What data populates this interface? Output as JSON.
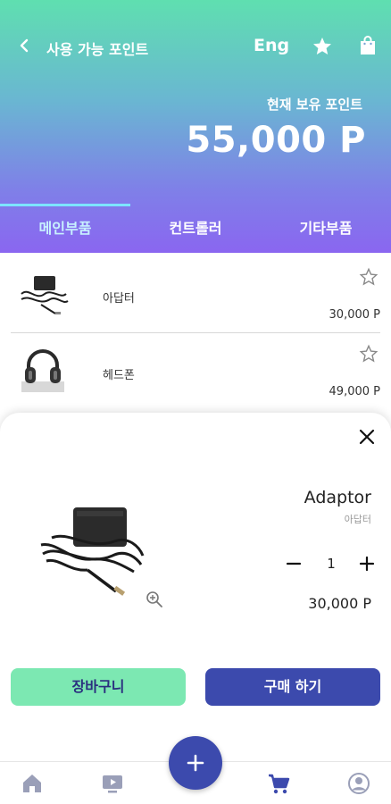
{
  "header": {
    "title": "사용 가능 포인트",
    "lang_label": "Eng",
    "points_label": "현재 보유 포인트",
    "points_value": "55,000 P"
  },
  "tabs": [
    {
      "label": "메인부품",
      "active": true
    },
    {
      "label": "컨트롤러",
      "active": false
    },
    {
      "label": "기타부품",
      "active": false
    }
  ],
  "items": [
    {
      "name": "아답터",
      "price": "30,000 P",
      "icon": "adapter-thumbnail"
    },
    {
      "name": "헤드폰",
      "price": "49,000 P",
      "icon": "headphone-thumbnail"
    }
  ],
  "detail": {
    "title": "Adaptor",
    "subtitle": "아답터",
    "quantity": "1",
    "price": "30,000 P",
    "cart_label": "장바구니",
    "buy_label": "구매 하기"
  },
  "nav": {
    "items": [
      "home-icon",
      "video-icon",
      "add-icon",
      "cart-icon",
      "profile-icon"
    ],
    "active": "cart-icon"
  },
  "colors": {
    "gradient_top": "#5fdfb0",
    "gradient_bottom": "#8a66f0",
    "primary": "#3c4aad",
    "cart_button": "#7ce8b2"
  }
}
